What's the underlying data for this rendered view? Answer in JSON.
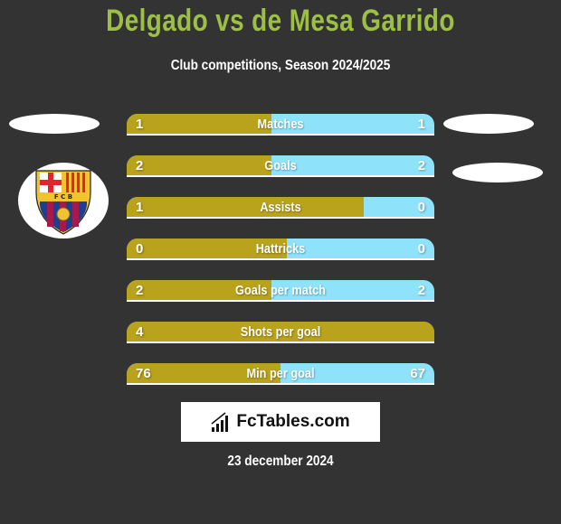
{
  "header": {
    "title": "Delgado vs de Mesa Garrido",
    "subtitle": "Club competitions, Season 2024/2025"
  },
  "left_team": {
    "logo_icon": "fc-barcelona-crest-icon"
  },
  "colors": {
    "left": "#b9a21c",
    "right": "#8ee3fb",
    "title": "#9dbf45"
  },
  "stats": [
    {
      "label": "Matches",
      "left": "1",
      "right": "1",
      "left_share": 0.47
    },
    {
      "label": "Goals",
      "left": "2",
      "right": "2",
      "left_share": 0.47
    },
    {
      "label": "Assists",
      "left": "1",
      "right": "0",
      "left_share": 0.77
    },
    {
      "label": "Hattricks",
      "left": "0",
      "right": "0",
      "left_share": 0.52
    },
    {
      "label": "Goals per match",
      "left": "2",
      "right": "2",
      "left_share": 0.47
    },
    {
      "label": "Shots per goal",
      "left": "4",
      "right": "",
      "left_share": 1.0
    },
    {
      "label": "Min per goal",
      "left": "76",
      "right": "67",
      "left_share": 0.5
    }
  ],
  "brand": {
    "icon": "bar-chart-icon",
    "text": "FcTables.com"
  },
  "date": "23 december 2024"
}
